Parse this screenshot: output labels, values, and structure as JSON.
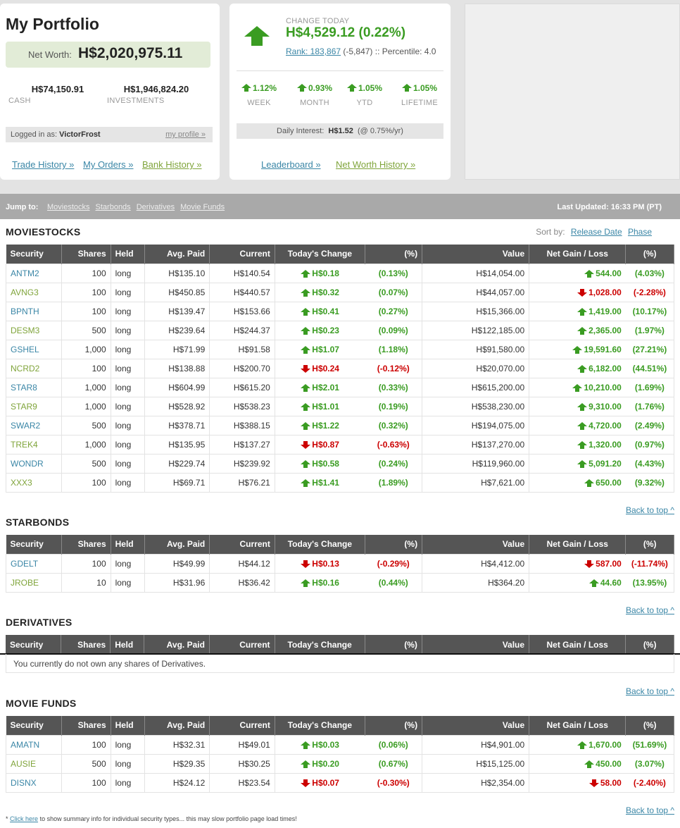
{
  "summary": {
    "title": "My Portfolio",
    "net_worth_label": "Net Worth:",
    "net_worth": "H$2,020,975.11",
    "cash": "H$74,150.91",
    "cash_label": "CASH",
    "investments": "H$1,946,824.20",
    "investments_label": "INVESTMENTS",
    "logged_in_label": "Logged in as:",
    "username": "VictorFrost",
    "profile_link": "my profile »",
    "links": [
      "Trade History »",
      "My Orders »",
      "Bank History »"
    ]
  },
  "change": {
    "label": "CHANGE TODAY",
    "value": "H$4,529.12 (0.22%)",
    "rank_link": "Rank: 183,867",
    "rank_rest": "(-5,847) :: Percentile: 4.0",
    "periods": [
      {
        "value": "1.12%",
        "label": "WEEK"
      },
      {
        "value": "0.93%",
        "label": "MONTH"
      },
      {
        "value": "1.05%",
        "label": "YTD"
      },
      {
        "value": "1.05%",
        "label": "LIFETIME"
      }
    ],
    "interest_label": "Daily Interest:",
    "interest_value": "H$1.52",
    "interest_rate": "(@ 0.75%/yr)",
    "links": [
      "Leaderboard »",
      "Net Worth History »"
    ]
  },
  "jumpbar": {
    "label": "Jump to:",
    "links": [
      "Moviestocks",
      "Starbonds",
      "Derivatives",
      "Movie Funds"
    ],
    "updated": "Last Updated: 16:33 PM (PT)"
  },
  "sortby": {
    "label": "Sort by:",
    "options": [
      "Release Date",
      "Phase"
    ]
  },
  "columns": [
    "Security",
    "Shares",
    "Held",
    "Avg. Paid",
    "Current",
    "Today's Change",
    "(%)",
    "Value",
    "Net Gain / Loss",
    "(%)"
  ],
  "back_to_top": "Back to top ^",
  "sections": {
    "moviestocks": {
      "title": "MOVIESTOCKS",
      "rows": [
        {
          "sym": "ANTM2",
          "shares": "100",
          "held": "long",
          "avg": "H$135.10",
          "cur": "H$140.54",
          "chg": "H$0.18",
          "chgp": "(0.13%)",
          "dir": "up",
          "val": "H$14,054.00",
          "gain": "544.00",
          "gainp": "(4.03%)",
          "gdir": "up"
        },
        {
          "sym": "AVNG3",
          "shares": "100",
          "held": "long",
          "avg": "H$450.85",
          "cur": "H$440.57",
          "chg": "H$0.32",
          "chgp": "(0.07%)",
          "dir": "up",
          "val": "H$44,057.00",
          "gain": "1,028.00",
          "gainp": "(-2.28%)",
          "gdir": "dn"
        },
        {
          "sym": "BPNTH",
          "shares": "100",
          "held": "long",
          "avg": "H$139.47",
          "cur": "H$153.66",
          "chg": "H$0.41",
          "chgp": "(0.27%)",
          "dir": "up",
          "val": "H$15,366.00",
          "gain": "1,419.00",
          "gainp": "(10.17%)",
          "gdir": "up"
        },
        {
          "sym": "DESM3",
          "shares": "500",
          "held": "long",
          "avg": "H$239.64",
          "cur": "H$244.37",
          "chg": "H$0.23",
          "chgp": "(0.09%)",
          "dir": "up",
          "val": "H$122,185.00",
          "gain": "2,365.00",
          "gainp": "(1.97%)",
          "gdir": "up"
        },
        {
          "sym": "GSHEL",
          "shares": "1,000",
          "held": "long",
          "avg": "H$71.99",
          "cur": "H$91.58",
          "chg": "H$1.07",
          "chgp": "(1.18%)",
          "dir": "up",
          "val": "H$91,580.00",
          "gain": "19,591.60",
          "gainp": "(27.21%)",
          "gdir": "up"
        },
        {
          "sym": "NCRD2",
          "shares": "100",
          "held": "long",
          "avg": "H$138.88",
          "cur": "H$200.70",
          "chg": "H$0.24",
          "chgp": "(-0.12%)",
          "dir": "dn",
          "val": "H$20,070.00",
          "gain": "6,182.00",
          "gainp": "(44.51%)",
          "gdir": "up"
        },
        {
          "sym": "STAR8",
          "shares": "1,000",
          "held": "long",
          "avg": "H$604.99",
          "cur": "H$615.20",
          "chg": "H$2.01",
          "chgp": "(0.33%)",
          "dir": "up",
          "val": "H$615,200.00",
          "gain": "10,210.00",
          "gainp": "(1.69%)",
          "gdir": "up"
        },
        {
          "sym": "STAR9",
          "shares": "1,000",
          "held": "long",
          "avg": "H$528.92",
          "cur": "H$538.23",
          "chg": "H$1.01",
          "chgp": "(0.19%)",
          "dir": "up",
          "val": "H$538,230.00",
          "gain": "9,310.00",
          "gainp": "(1.76%)",
          "gdir": "up"
        },
        {
          "sym": "SWAR2",
          "shares": "500",
          "held": "long",
          "avg": "H$378.71",
          "cur": "H$388.15",
          "chg": "H$1.22",
          "chgp": "(0.32%)",
          "dir": "up",
          "val": "H$194,075.00",
          "gain": "4,720.00",
          "gainp": "(2.49%)",
          "gdir": "up"
        },
        {
          "sym": "TREK4",
          "shares": "1,000",
          "held": "long",
          "avg": "H$135.95",
          "cur": "H$137.27",
          "chg": "H$0.87",
          "chgp": "(-0.63%)",
          "dir": "dn",
          "val": "H$137,270.00",
          "gain": "1,320.00",
          "gainp": "(0.97%)",
          "gdir": "up"
        },
        {
          "sym": "WONDR",
          "shares": "500",
          "held": "long",
          "avg": "H$229.74",
          "cur": "H$239.92",
          "chg": "H$0.58",
          "chgp": "(0.24%)",
          "dir": "up",
          "val": "H$119,960.00",
          "gain": "5,091.20",
          "gainp": "(4.43%)",
          "gdir": "up"
        },
        {
          "sym": "XXX3",
          "shares": "100",
          "held": "long",
          "avg": "H$69.71",
          "cur": "H$76.21",
          "chg": "H$1.41",
          "chgp": "(1.89%)",
          "dir": "up",
          "val": "H$7,621.00",
          "gain": "650.00",
          "gainp": "(9.32%)",
          "gdir": "up"
        }
      ]
    },
    "starbonds": {
      "title": "STARBONDS",
      "rows": [
        {
          "sym": "GDELT",
          "shares": "100",
          "held": "long",
          "avg": "H$49.99",
          "cur": "H$44.12",
          "chg": "H$0.13",
          "chgp": "(-0.29%)",
          "dir": "dn",
          "val": "H$4,412.00",
          "gain": "587.00",
          "gainp": "(-11.74%)",
          "gdir": "dn"
        },
        {
          "sym": "JROBE",
          "shares": "10",
          "held": "long",
          "avg": "H$31.96",
          "cur": "H$36.42",
          "chg": "H$0.16",
          "chgp": "(0.44%)",
          "dir": "up",
          "val": "H$364.20",
          "gain": "44.60",
          "gainp": "(13.95%)",
          "gdir": "up"
        }
      ]
    },
    "derivatives": {
      "title": "DERIVATIVES",
      "empty_message": "You currently do not own any shares of Derivatives.",
      "rows": []
    },
    "movie_funds": {
      "title": "MOVIE FUNDS",
      "rows": [
        {
          "sym": "AMATN",
          "shares": "100",
          "held": "long",
          "avg": "H$32.31",
          "cur": "H$49.01",
          "chg": "H$0.03",
          "chgp": "(0.06%)",
          "dir": "up",
          "val": "H$4,901.00",
          "gain": "1,670.00",
          "gainp": "(51.69%)",
          "gdir": "up"
        },
        {
          "sym": "AUSIE",
          "shares": "500",
          "held": "long",
          "avg": "H$29.35",
          "cur": "H$30.25",
          "chg": "H$0.20",
          "chgp": "(0.67%)",
          "dir": "up",
          "val": "H$15,125.00",
          "gain": "450.00",
          "gainp": "(3.07%)",
          "gdir": "up"
        },
        {
          "sym": "DISNX",
          "shares": "100",
          "held": "long",
          "avg": "H$24.12",
          "cur": "H$23.54",
          "chg": "H$0.07",
          "chgp": "(-0.30%)",
          "dir": "dn",
          "val": "H$2,354.00",
          "gain": "58.00",
          "gainp": "(-2.40%)",
          "gdir": "dn"
        }
      ]
    }
  },
  "footnote": {
    "prefix": "*",
    "link": "Click here",
    "rest": "to show summary info for individual security types... this may slow portfolio page load times!"
  },
  "colors": {
    "up": "#3a9c22",
    "down": "#cc0000",
    "link": "#3a86a6",
    "link_alt": "#7fa43a",
    "header_bg": "#555555"
  }
}
